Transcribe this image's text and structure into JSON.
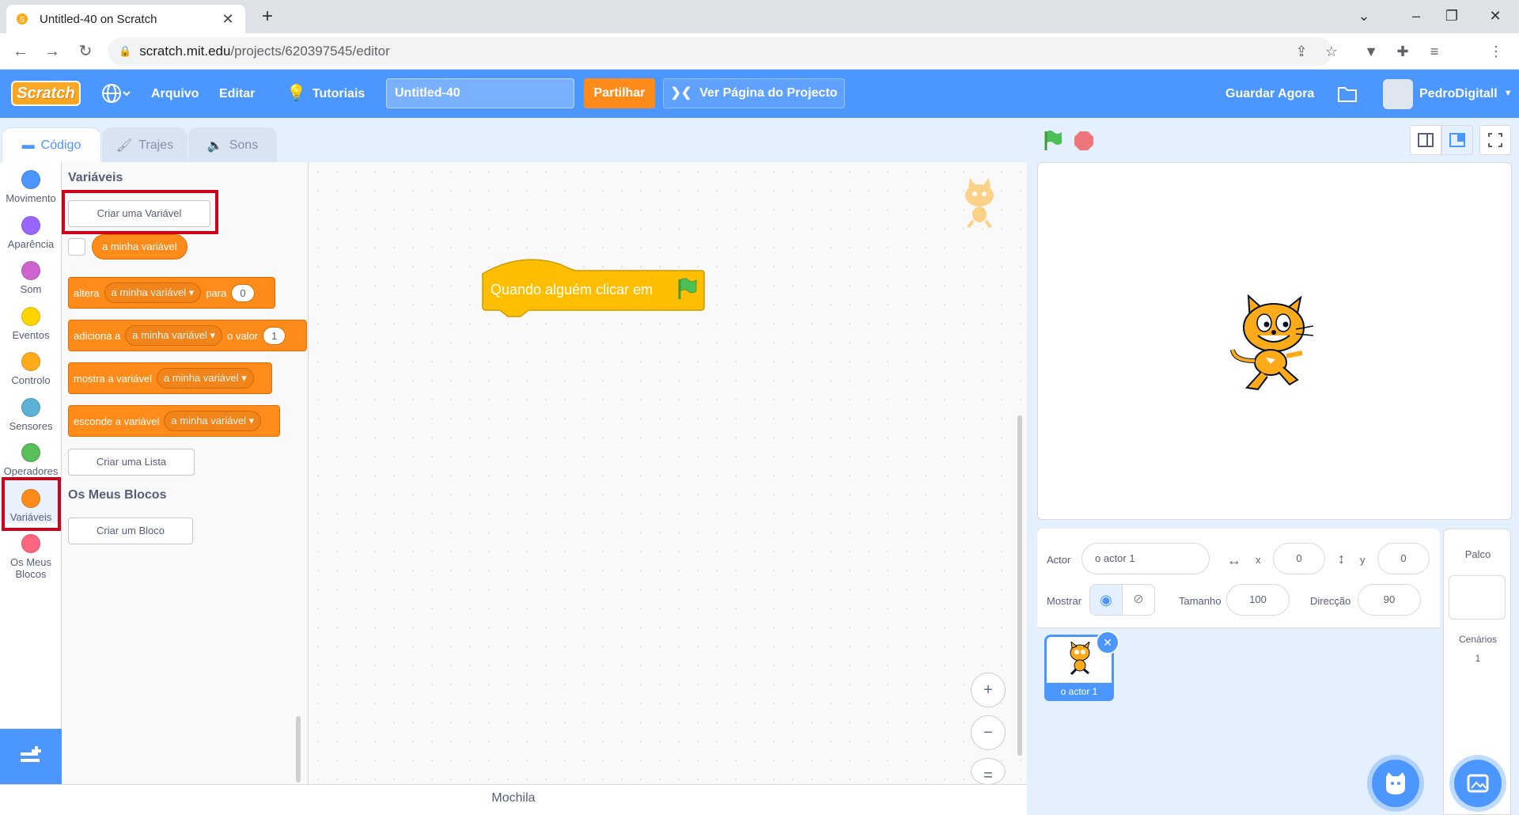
{
  "browser": {
    "tab_title": "Untitled-40 on Scratch",
    "url_host": "scratch.mit.edu",
    "url_path": "/projects/620397545/editor"
  },
  "menubar": {
    "file": "Arquivo",
    "edit": "Editar",
    "tutorials": "Tutoriais",
    "project_title": "Untitled-40",
    "share": "Partilhar",
    "see_project_page": "Ver Página do Projecto",
    "save_now": "Guardar Agora",
    "username": "PedroDigitall"
  },
  "editor_tabs": [
    "Código",
    "Trajes",
    "Sons"
  ],
  "categories": [
    {
      "label": "Movimento",
      "color": "#4c97ff"
    },
    {
      "label": "Aparência",
      "color": "#9966ff"
    },
    {
      "label": "Som",
      "color": "#cf63cf"
    },
    {
      "label": "Eventos",
      "color": "#ffd500"
    },
    {
      "label": "Controlo",
      "color": "#ffab19"
    },
    {
      "label": "Sensores",
      "color": "#5cb1d6"
    },
    {
      "label": "Operadores",
      "color": "#59c059"
    },
    {
      "label": "Variáveis",
      "color": "#ff8c1a"
    },
    {
      "label": "Os Meus Blocos",
      "color": "#ff6680"
    }
  ],
  "palette": {
    "variables_heading": "Variáveis",
    "make_variable": "Criar uma Variável",
    "variable_name": "a minha variável",
    "set_block": {
      "prefix": "altera",
      "var": "a minha variável",
      "mid": "para",
      "value": "0"
    },
    "change_block": {
      "prefix": "adiciona a",
      "var": "a minha variável",
      "mid": "o valor",
      "value": "1"
    },
    "show_block": {
      "prefix": "mostra a variável",
      "var": "a minha variável"
    },
    "hide_block": {
      "prefix": "esconde a variável",
      "var": "a minha variável"
    },
    "make_list": "Criar uma Lista",
    "myblocks_heading": "Os Meus Blocos",
    "make_block": "Criar um Bloco"
  },
  "workspace": {
    "hat_block_text": "Quando alguém clicar em",
    "zoom_in": "+",
    "zoom_out": "−",
    "zoom_reset": "="
  },
  "backpack": "Mochila",
  "sprite_info": {
    "sprite_label": "Actor",
    "sprite_name": "o actor 1",
    "x_label": "x",
    "x": "0",
    "y_label": "y",
    "y": "0",
    "show_label": "Mostrar",
    "size_label": "Tamanho",
    "size": "100",
    "direction_label": "Direcção",
    "direction": "90"
  },
  "sprite_list": [
    {
      "name": "o actor 1"
    }
  ],
  "stage_panel": {
    "title": "Palco",
    "backdrops_label": "Cenários",
    "backdrops_count": "1"
  },
  "colors": {
    "menubar": "#4c97ff",
    "variables": "#ff8c1a",
    "events": "#ffbf00",
    "highlight": "#d0021b"
  }
}
